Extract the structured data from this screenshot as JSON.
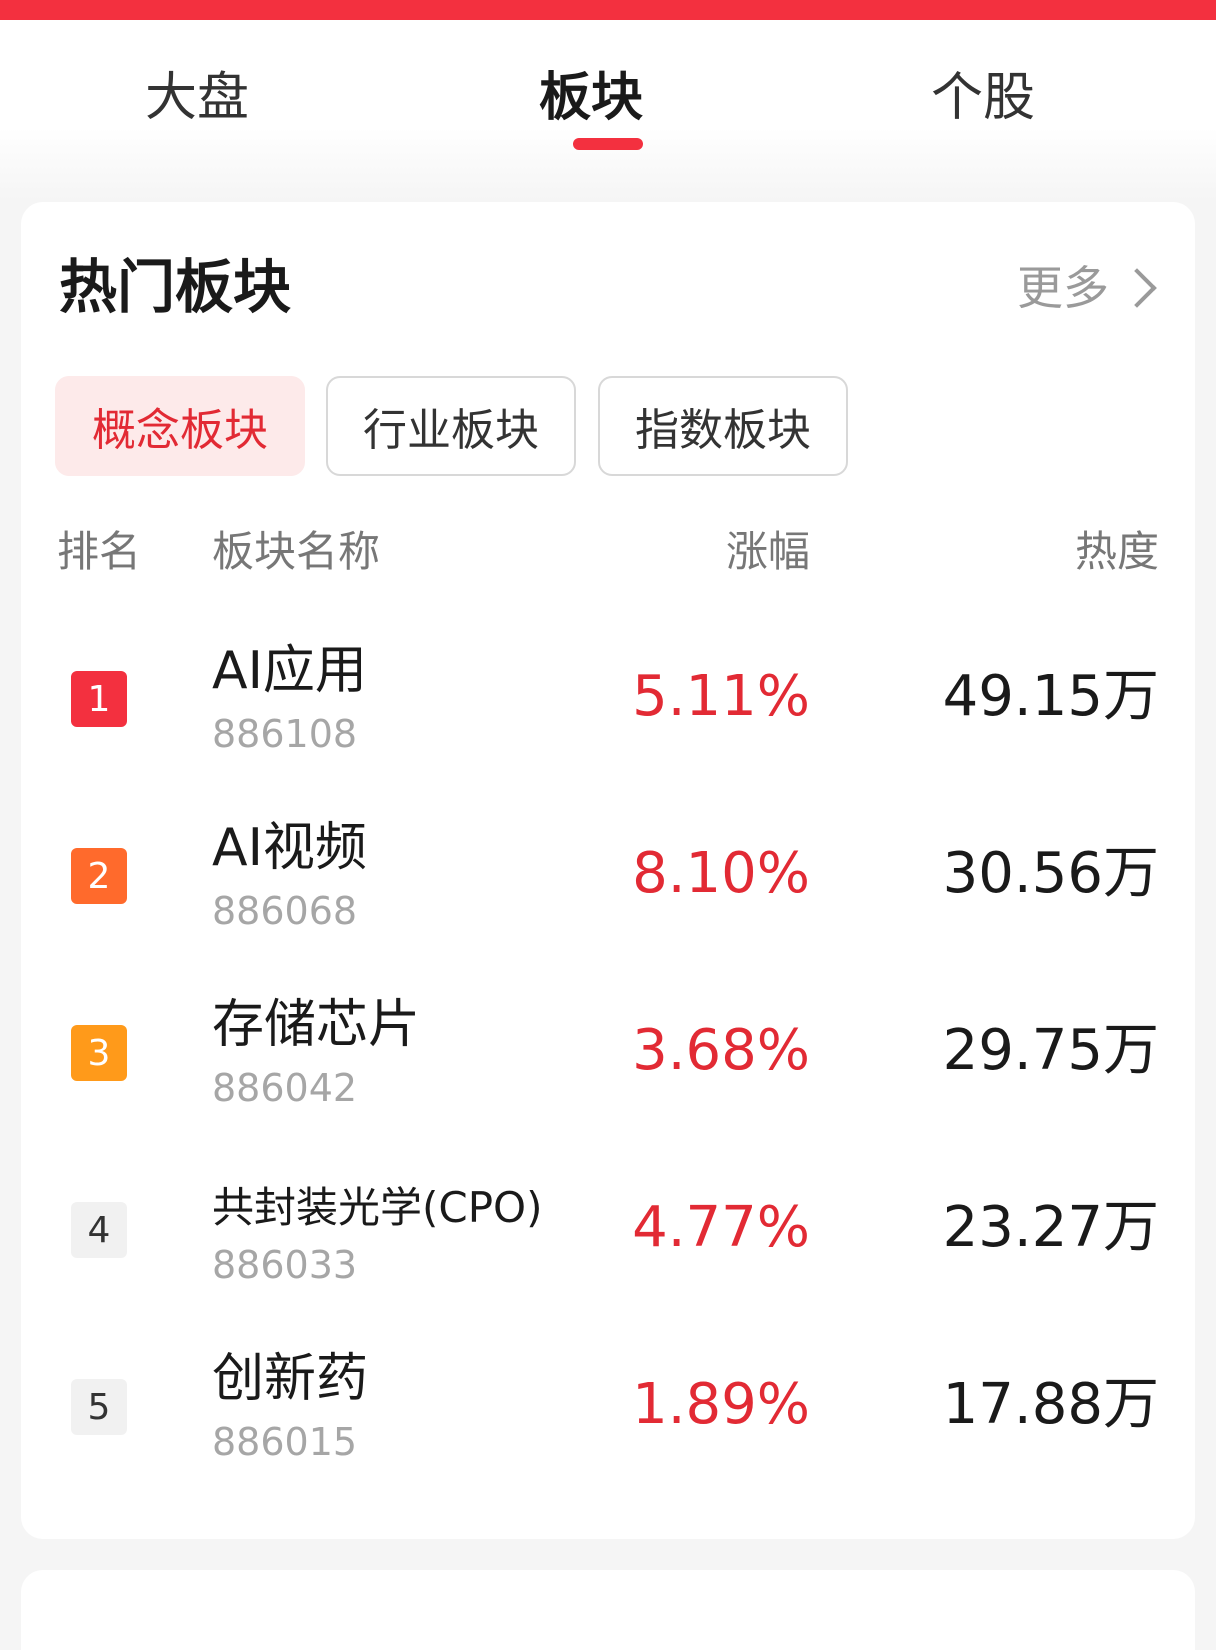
{
  "tabs": [
    {
      "label": "大盘",
      "active": false
    },
    {
      "label": "板块",
      "active": true
    },
    {
      "label": "个股",
      "active": false
    }
  ],
  "section": {
    "title": "热门板块",
    "more_label": "更多"
  },
  "filters": [
    {
      "label": "概念板块",
      "active": true
    },
    {
      "label": "行业板块",
      "active": false
    },
    {
      "label": "指数板块",
      "active": false
    }
  ],
  "columns": {
    "rank": "排名",
    "name": "板块名称",
    "change": "涨幅",
    "heat": "热度"
  },
  "rows": [
    {
      "rank": "1",
      "name": "AI应用",
      "code": "886108",
      "change": "5.11%",
      "heat": "49.15万",
      "badge_color": "#f3303f"
    },
    {
      "rank": "2",
      "name": "AI视频",
      "code": "886068",
      "change": "8.10%",
      "heat": "30.56万",
      "badge_color": "#ff6a2c"
    },
    {
      "rank": "3",
      "name": "存储芯片",
      "code": "886042",
      "change": "3.68%",
      "heat": "29.75万",
      "badge_color": "#ff9a1a"
    },
    {
      "rank": "4",
      "name": "共封装光学(CPO)",
      "code": "886033",
      "change": "4.77%",
      "heat": "23.27万",
      "badge_color": ""
    },
    {
      "rank": "5",
      "name": "创新药",
      "code": "886015",
      "change": "1.89%",
      "heat": "17.88万",
      "badge_color": ""
    }
  ],
  "colors": {
    "accent": "#f3303f",
    "rise": "#e22a34"
  }
}
